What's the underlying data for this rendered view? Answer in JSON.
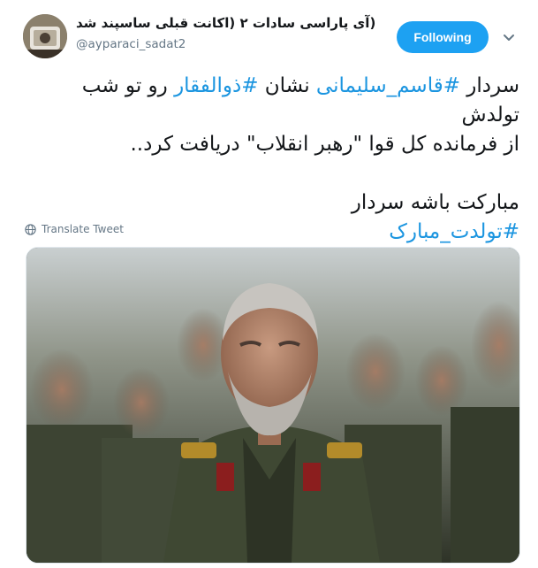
{
  "tweet": {
    "display_name": "(آی پاراسی سادات ۲ (اکانت قبلی ساسپند شد",
    "handle": "@ayparaci_sadat2",
    "follow_label": "Following",
    "menu_icon": "chevron-down-icon",
    "body": {
      "line1_pre": "سردار ",
      "line1_tag1": "#قاسم_سلیمانی",
      "line1_mid": " نشان ",
      "line1_tag2": "#ذوالفقار",
      "line1_post": " رو تو شب تولدش",
      "line2": "از فرمانده کل قوا \"رهبر انقلاب\" دریافت کرد..",
      "line3": "مبارکت باشه سردار",
      "hashtag_birthday": "#تولدت_مبارک"
    },
    "translate_label": "Translate Tweet",
    "media_alt": "photo"
  },
  "colors": {
    "accent": "#1da1f2",
    "hashtag": "#1b95e0",
    "secondary_text": "#657786"
  }
}
